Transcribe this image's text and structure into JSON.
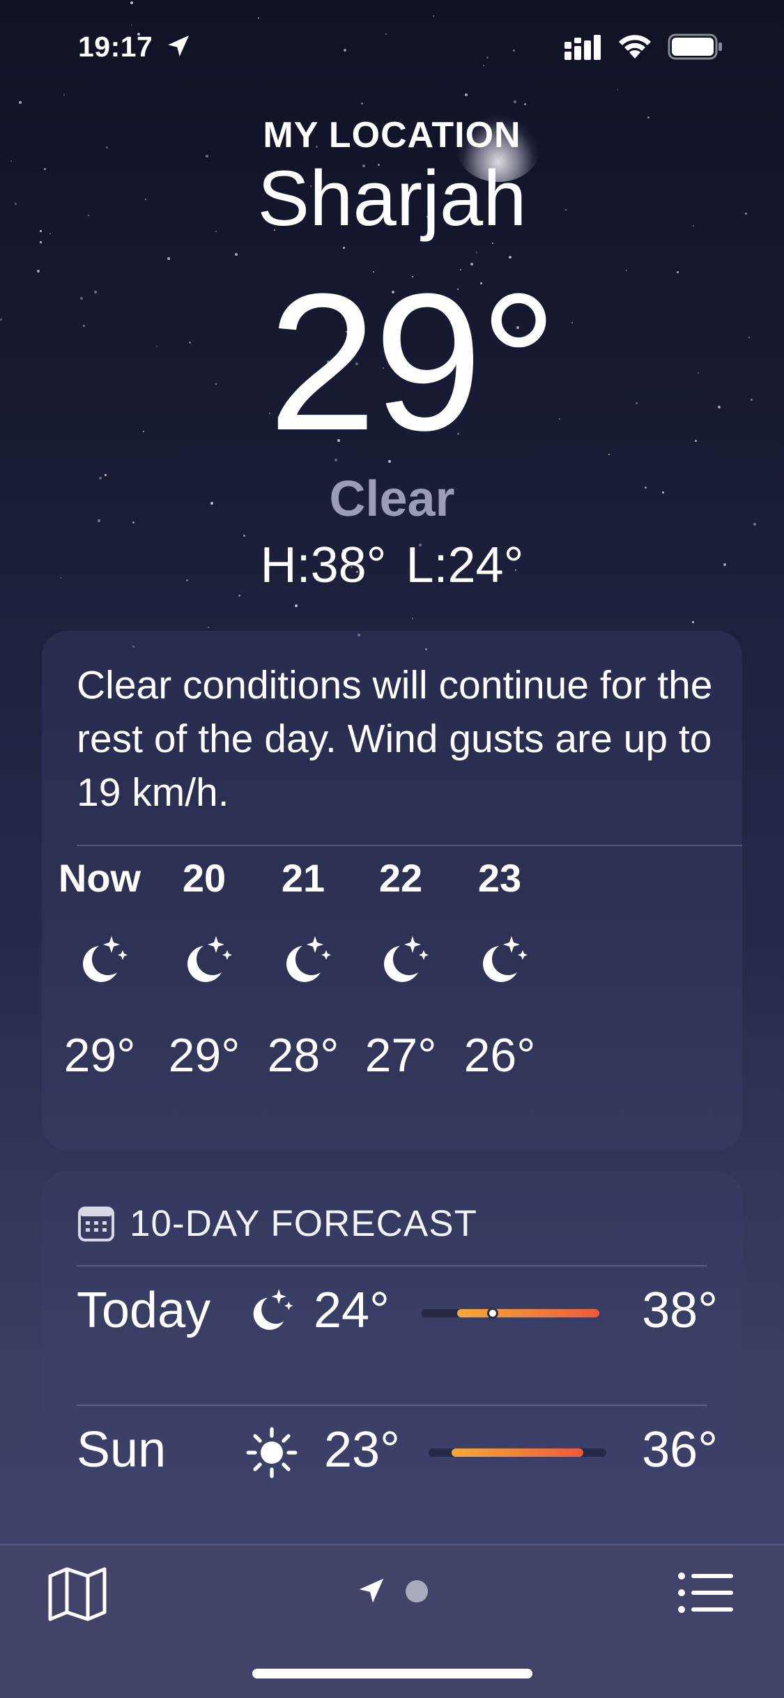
{
  "status_bar": {
    "time": "19:17",
    "icons": [
      "location-arrow-icon",
      "cellular-signal-icon",
      "wifi-icon",
      "battery-icon"
    ]
  },
  "header": {
    "location_label": "MY LOCATION",
    "city": "Sharjah",
    "temperature": "29°",
    "condition": "Clear",
    "high": "H:38°",
    "low": "L:24°"
  },
  "hourly": {
    "summary": "Clear conditions will continue for the rest of the day. Wind gusts are up to 19 km/h.",
    "hours": [
      {
        "label": "Now",
        "icon": "moon-stars-icon",
        "temp": "29°"
      },
      {
        "label": "20",
        "icon": "moon-stars-icon",
        "temp": "29°"
      },
      {
        "label": "21",
        "icon": "moon-stars-icon",
        "temp": "28°"
      },
      {
        "label": "22",
        "icon": "moon-stars-icon",
        "temp": "27°"
      },
      {
        "label": "23",
        "icon": "moon-stars-icon",
        "temp": "26°"
      }
    ]
  },
  "forecast": {
    "title": "10-DAY FORECAST",
    "days": [
      {
        "day": "Today",
        "icon": "moon-stars-icon",
        "low": "24°",
        "high": "38°",
        "range_start": 0.2,
        "range_end": 1.0,
        "current": 0.4
      },
      {
        "day": "Sun",
        "icon": "sun-icon",
        "low": "23°",
        "high": "36°",
        "range_start": 0.13,
        "range_end": 0.87
      }
    ]
  },
  "colors": {
    "bar_warm": "#f5a93a",
    "bar_hot": "#ec5b3c",
    "condition_text": "#9b9db6"
  },
  "toolbar": {
    "icons": [
      "map-icon",
      "location-arrow-icon",
      "page-dot",
      "list-icon"
    ]
  }
}
